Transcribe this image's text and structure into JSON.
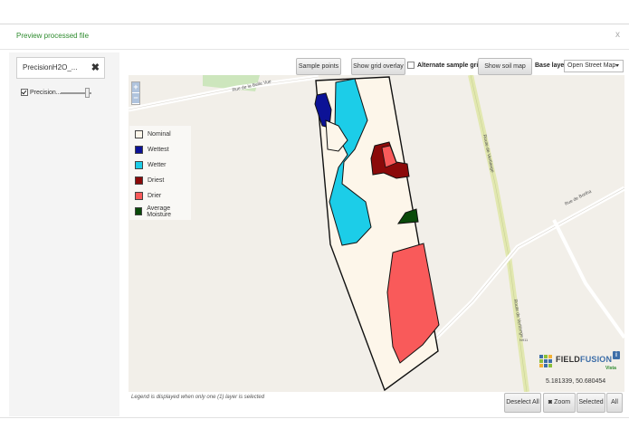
{
  "modal": {
    "title": "Preview processed file",
    "close": "x"
  },
  "sidebar": {
    "layer_tab": "PrecisionH2O_...",
    "layer_close": "✖",
    "layer_name": "Precision..."
  },
  "toolbar": {
    "sample_points": "Sample points",
    "show_grid_overlay": "Show grid overlay",
    "alternate_sample_grid": "Alternate sample grid",
    "show_soil_map": "Show soil map",
    "base_layer_label": "Base layer:",
    "base_layer_value": "Open Street Map"
  },
  "map": {
    "zoom_in": "+",
    "zoom_out": "−",
    "road_labels": {
      "belle_vue": "Rue de la Belle Vue",
      "bortha": "Rue de Bortha",
      "vertlange": "Route de Vertlange",
      "road_id": "N911"
    },
    "coords": "5.181339, 50.680454",
    "info": "i"
  },
  "legend": {
    "items": [
      {
        "label": "Nominal",
        "color": "#fdf6ea"
      },
      {
        "label": "Wettest",
        "color": "#0c1296"
      },
      {
        "label": "Wetter",
        "color": "#1ccde8"
      },
      {
        "label": "Driest",
        "color": "#8b0a0a"
      },
      {
        "label": "Drier",
        "color": "#f95a5a"
      },
      {
        "label": "Average Moisture",
        "color": "#0a4a0a"
      }
    ],
    "note": "Legend is displayed when only one (1) layer is selected"
  },
  "logo": {
    "field": "FIELD",
    "fusion": "FUSION",
    "sub": "Vista"
  },
  "footer_buttons": {
    "deselect_all": "Deselect All",
    "zoom": "Zoom",
    "selected": "Selected",
    "all": "All"
  }
}
